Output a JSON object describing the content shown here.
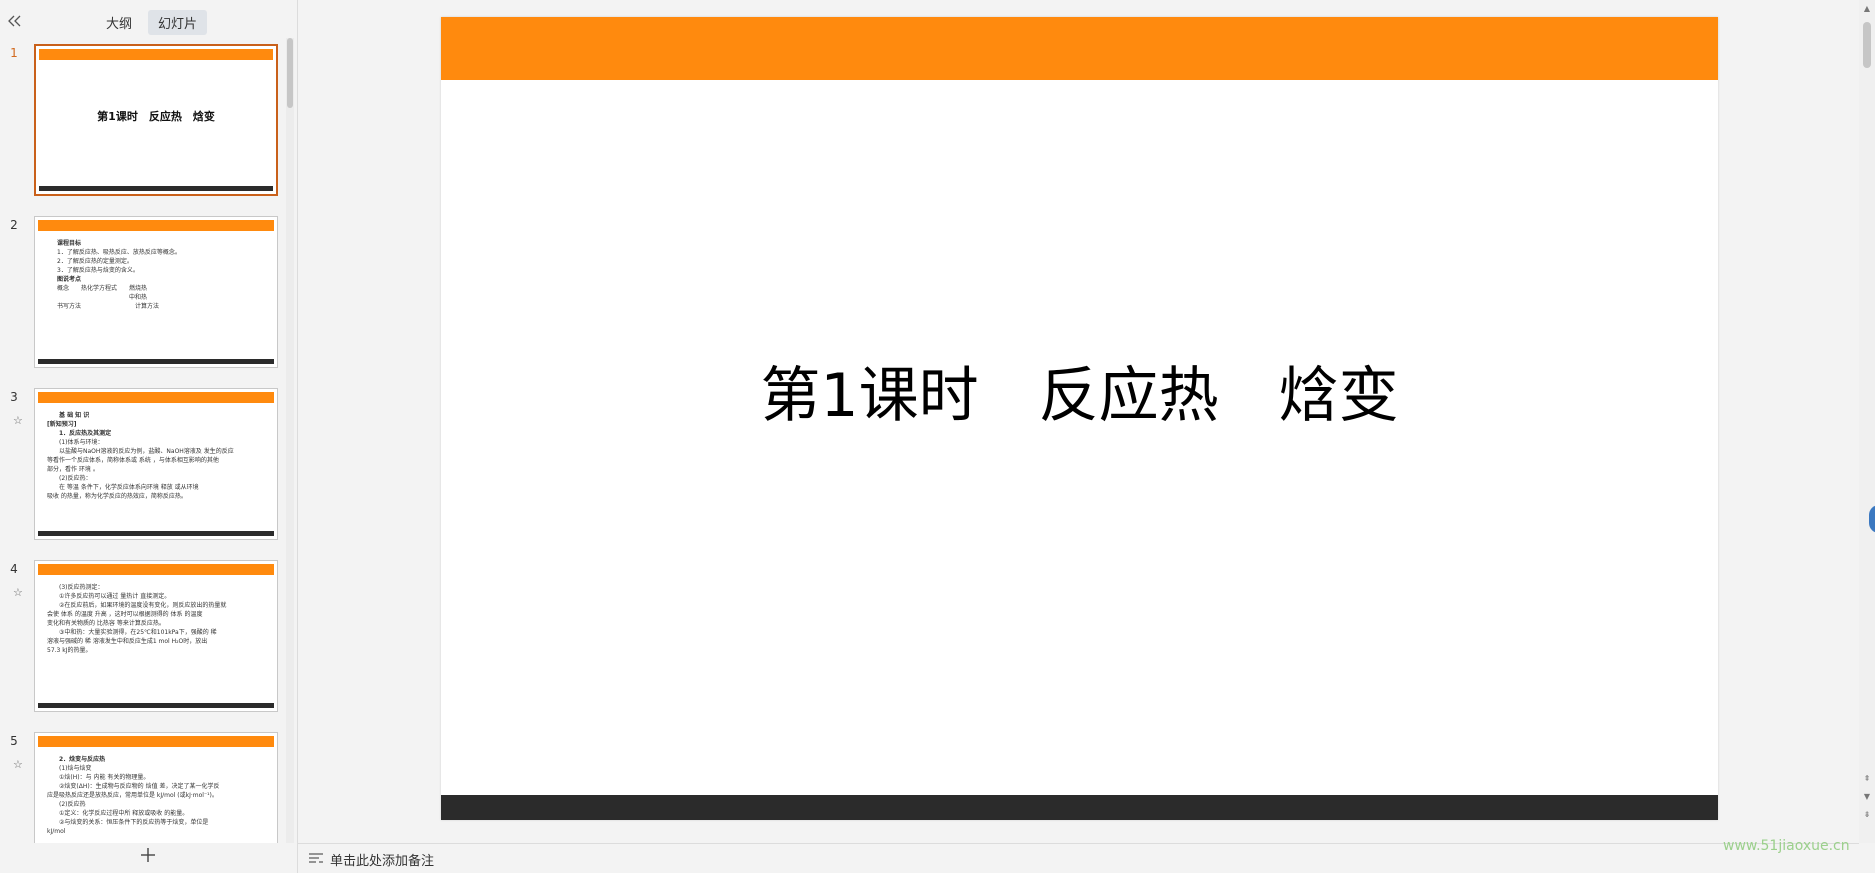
{
  "left_panel": {
    "tabs": [
      {
        "label": "大纲",
        "active": false
      },
      {
        "label": "幻灯片",
        "active": true
      }
    ],
    "slides": [
      {
        "number": "1",
        "title": "第1课时　反应热　焓变",
        "lines": [],
        "starred": false
      },
      {
        "number": "2",
        "title": "",
        "starred": false,
        "lines": [
          "课程目标",
          "1．了解反应热、吸热反应、放热反应等概念。",
          "2．了解反应热的定量测定。",
          "3．了解反应热与焓变的含义。",
          "图说考点",
          "概念　　热化学方程式　　燃烧热",
          "　　　　　　　　　　　　中和热",
          "书写方法　　　　　　　　　计算方法"
        ]
      },
      {
        "number": "3",
        "title": "",
        "starred": true,
        "lines": [
          "基 础 知 识",
          "[新知预习]",
          "1．反应热及其测定",
          "(1)体系与环境：",
          "以盐酸与NaOH溶液的反应为例，盐酸、NaOH溶液及 发生的反应",
          "等看作一个反应体系，简称体系或 系统 ，与体系相互影响的其他",
          "部分，看作 环境 。",
          "(2)反应热：",
          "在 等温 条件下，化学反应体系向环境 释放 或从环境",
          "吸收 的热量，称为化学反应的热效应，简称反应热。"
        ]
      },
      {
        "number": "4",
        "title": "",
        "starred": true,
        "lines": [
          "(3)反应热测定：",
          "①许多反应热可以通过 量热计 直接测定。",
          "②在反应前后，如果环境的温度没有变化，则反应放出的热量就",
          "会使 体系 的温度 升高 ，这时可以根据测得的 体系 的温度",
          "变化和有关物质的 比热容 等来计算反应热。",
          "③中和热：大量实验测得，在25℃和101kPa下，强酸的 稀",
          "溶液与强碱的 稀 溶液发生中和反应生成1 mol H₂O时，放出",
          "57.3 kJ的热量。"
        ]
      },
      {
        "number": "5",
        "title": "",
        "starred": true,
        "lines": [
          "2．焓变与反应热",
          "(1)焓与焓变",
          "①焓(H)：与 内能 有关的物理量。",
          "②焓变(ΔH)：生成物与反应物的 焓值 差，决定了某一化学反",
          "应是吸热反应还是放热反应，常用单位是 kJ/mol (或kJ·mol⁻¹)。",
          "(2)反应热",
          "①定义：化学反应过程中所 释放或吸收 的能量。",
          "②与焓变的关系：恒压条件下的反应热等于焓变，单位是",
          "kJ/mol"
        ]
      }
    ],
    "selected_slide": "1"
  },
  "slide": {
    "title": "第1课时　反应热　焓变",
    "accent_color": "#ff8a0e",
    "footer_color": "#2b2b2b"
  },
  "notes": {
    "placeholder": "单击此处添加备注"
  },
  "watermark": "www.51jiaoxue.cn"
}
